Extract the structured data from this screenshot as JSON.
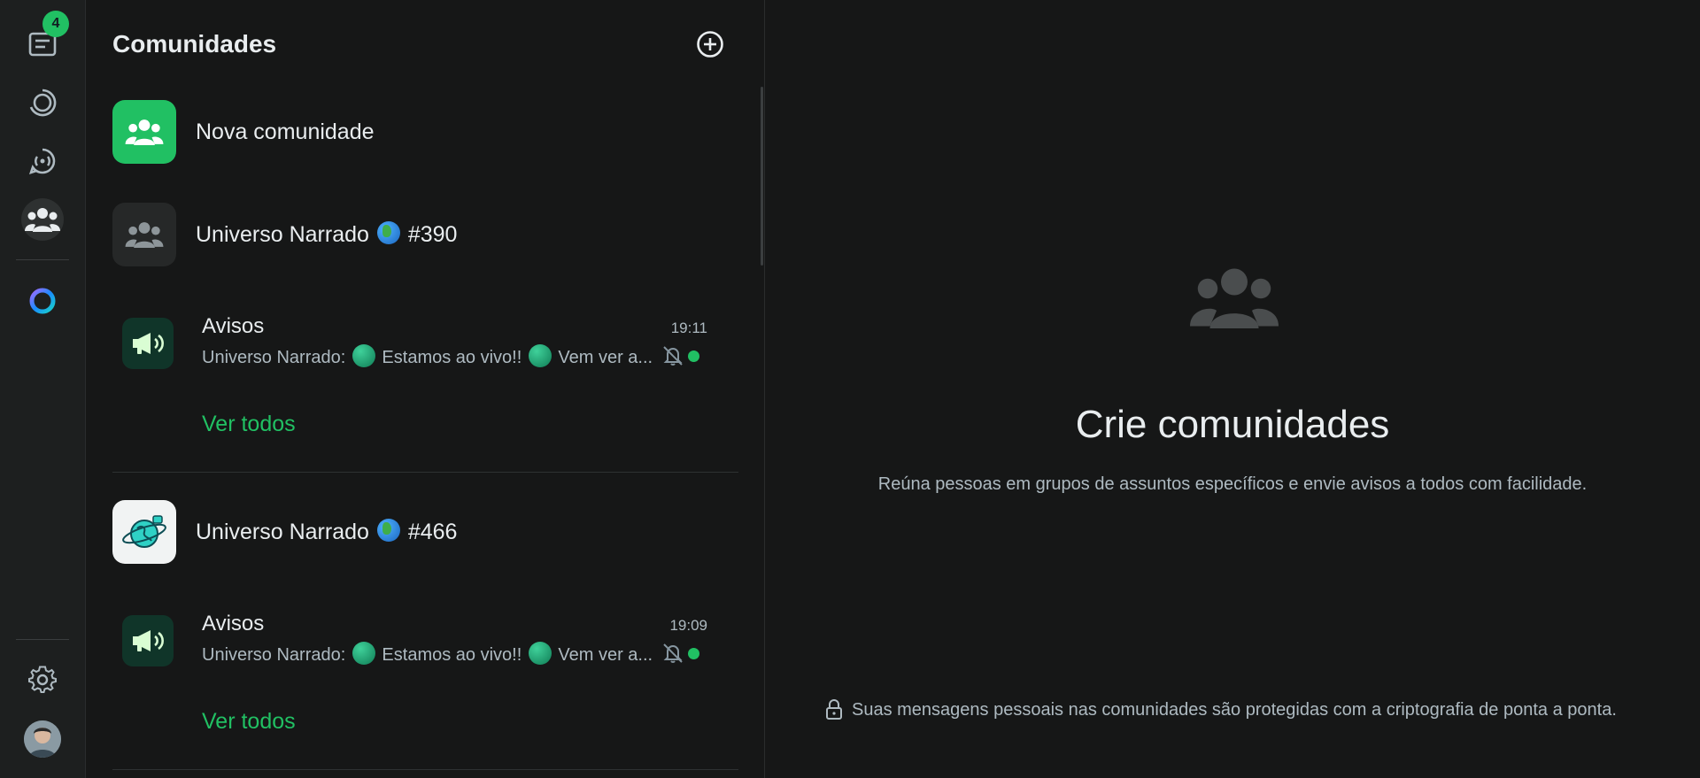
{
  "rail": {
    "chats_badge": "4"
  },
  "panel": {
    "title": "Comunidades"
  },
  "new_community": {
    "label": "Nova comunidade"
  },
  "communities": [
    {
      "name": "Universo Narrado",
      "suffix": "#390",
      "announcement": {
        "name": "Avisos",
        "time": "19:11",
        "preview_prefix": "Universo Narrado:",
        "preview_middle": "Estamos ao vivo!!",
        "preview_end": "Vem ver a..."
      },
      "see_all": "Ver todos"
    },
    {
      "name": "Universo Narrado",
      "suffix": "#466",
      "announcement": {
        "name": "Avisos",
        "time": "19:09",
        "preview_prefix": "Universo Narrado:",
        "preview_middle": "Estamos ao vivo!!",
        "preview_end": "Vem ver a..."
      },
      "see_all": "Ver todos"
    }
  ],
  "empty_state": {
    "title": "Crie comunidades",
    "subtitle": "Reúna pessoas em grupos de assuntos específicos e envie avisos a todos com facilidade.",
    "footer": "Suas mensagens pessoais nas comunidades são protegidas com a criptografia de ponta a ponta."
  },
  "colors": {
    "accent": "#21c063",
    "background": "#161717",
    "rail": "#1d1f1f",
    "announce_bg": "#103529"
  }
}
